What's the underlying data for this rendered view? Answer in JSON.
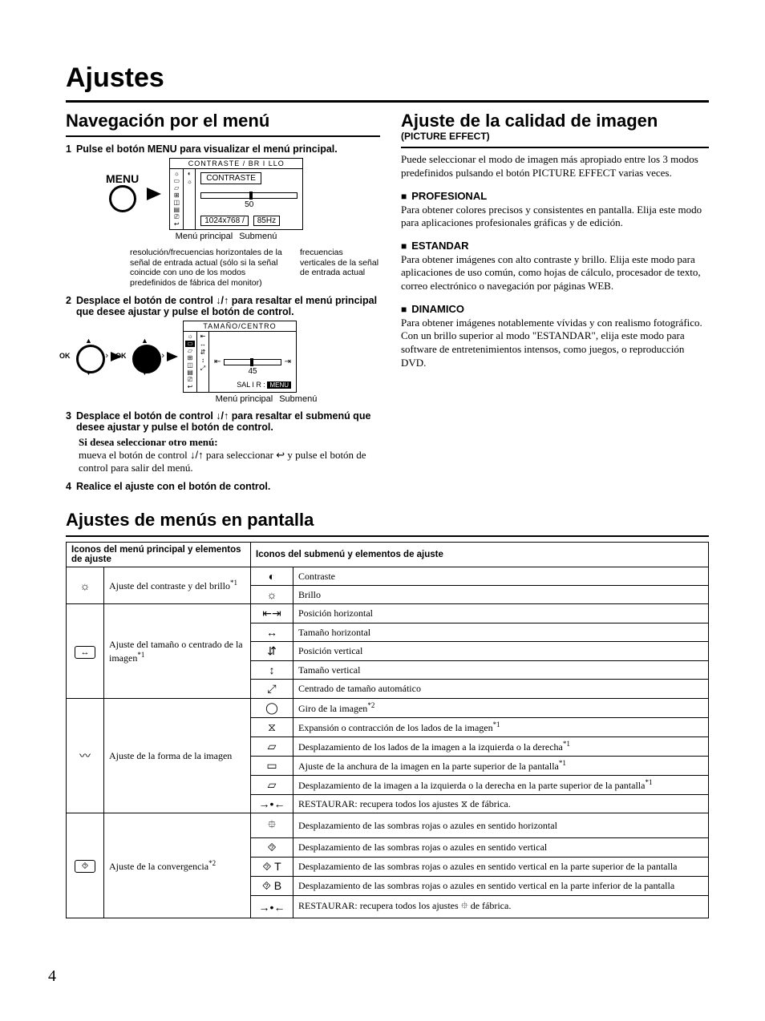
{
  "title": "Ajustes",
  "page_number": "4",
  "left": {
    "heading": "Navegación por el menú",
    "step1_num": "1",
    "step1_txt": "Pulse el botón MENU para visualizar el menú principal.",
    "menu_label": "MENU",
    "osd1": {
      "title": "CONTRASTE / BR I LLO",
      "item": "CONTRASTE",
      "value": "50",
      "res": "1024x768 /",
      "hz": "85Hz"
    },
    "fig1_cap_main": "Menú principal",
    "fig1_cap_sub": "Submenú",
    "note_left": "resolución/frecuencias horizontales de la señal de entrada actual (sólo si la señal coincide con uno de los modos predefinidos de fábrica del monitor)",
    "note_right": "frecuencias verticales de la señal de entrada actual",
    "step2_num": "2",
    "step2_txt": "Desplace el botón de control ↓/↑ para resaltar el menú principal que desee ajustar y pulse el botón de control.",
    "osd2": {
      "title": "TAMAÑO/CENTRO",
      "value": "45",
      "exit": "SAL I R :"
    },
    "fig2_cap_main": "Menú principal",
    "fig2_cap_sub": "Submenú",
    "step3_num": "3",
    "step3_txt": "Desplace el botón de control ↓/↑ para resaltar el submenú que desee ajustar y pulse el botón de control.",
    "step3_sub1": "Si desea seleccionar otro menú:",
    "step3_sub2a": "mueva el botón de control ",
    "step3_sub2b": " para seleccionar ",
    "step3_sub2c": " y pulse el botón de control para salir del menú.",
    "updown_glyph": "↓/↑",
    "return_glyph": "↩",
    "step4_num": "4",
    "step4_txt": "Realice el ajuste con el botón de control."
  },
  "right": {
    "heading": "Ajuste de la calidad de imagen",
    "subheading": "(PICTURE EFFECT)",
    "intro": "Puede seleccionar el modo de imagen más apropiado entre los 3 modos predefinidos pulsando el botón PICTURE EFFECT varias veces.",
    "m1": "PROFESIONAL",
    "m1_txt": "Para obtener colores precisos y consistentes en pantalla. Elija este modo para aplicaciones profesionales gráficas y de edición.",
    "m2": "ESTANDAR",
    "m2_txt": "Para obtener imágenes con alto contraste y brillo. Elija este modo para aplicaciones de uso común, como hojas de cálculo, procesador de texto, correo electrónico o navegación por páginas WEB.",
    "m3": "DINAMICO",
    "m3_txt": "Para obtener imágenes notablemente vívidas y con realismo fotográfico. Con un brillo superior al modo \"ESTANDAR\", elija este modo para software de entretenimientos intensos, como juegos, o reproducción DVD."
  },
  "lower": {
    "heading": "Ajustes de menús en pantalla",
    "th_main": "Iconos del menú principal y elementos de ajuste",
    "th_sub": "Iconos del submenú y elementos de ajuste",
    "groups": [
      {
        "icon": "☼",
        "desc": "Ajuste del contraste y del brillo",
        "note": "*1",
        "rows": [
          {
            "icon": "◐",
            "txt": "Contraste"
          },
          {
            "icon": "☼",
            "txt": "Brillo"
          }
        ]
      },
      {
        "icon": "↔",
        "boxed": true,
        "desc": "Ajuste del tamaño o centrado de la imagen",
        "note": "*1",
        "rows": [
          {
            "icon": "⇤⇥",
            "txt": "Posición horizontal"
          },
          {
            "icon": "↔",
            "txt": "Tamaño horizontal"
          },
          {
            "icon": "⇵",
            "txt": "Posición vertical"
          },
          {
            "icon": "↕",
            "txt": "Tamaño vertical"
          },
          {
            "icon": "⤢",
            "txt": "Centrado de tamaño automático"
          }
        ]
      },
      {
        "icon": "〰",
        "desc": "Ajuste de la forma de la imagen",
        "rows": [
          {
            "icon": "◯",
            "txt": "Giro de la imagen",
            "note": "*2"
          },
          {
            "icon": "⧖",
            "txt": "Expansión o contracción de los lados de la imagen",
            "note": "*1"
          },
          {
            "icon": "▱",
            "txt": "Desplazamiento de los lados de la imagen a la izquierda o la derecha",
            "note": "*1"
          },
          {
            "icon": "▭",
            "txt": "Ajuste de la anchura de la imagen en la parte superior de la pantalla",
            "note": "*1"
          },
          {
            "icon": "▱",
            "txt": "Desplazamiento de la imagen a la izquierda o la derecha en la parte superior de la pantalla",
            "note": "*1"
          },
          {
            "icon": "→•←",
            "txt_pre": "RESTAURAR: recupera todos los ajustes ",
            "icon2": "⧖",
            "txt_post": " de fábrica."
          }
        ]
      },
      {
        "icon": "⯑",
        "boxed": true,
        "desc": "Ajuste de la convergencia",
        "note": "*2",
        "rows": [
          {
            "icon": "⯐",
            "txt": "Desplazamiento de las sombras rojas o azules en sentido horizontal"
          },
          {
            "icon": "⯑",
            "txt": "Desplazamiento de las sombras rojas o azules en sentido vertical"
          },
          {
            "icon": "⯑ T",
            "txt": "Desplazamiento de las sombras rojas o azules en sentido vertical en la parte superior de la pantalla"
          },
          {
            "icon": "⯑ B",
            "txt": "Desplazamiento de las sombras rojas o azules en sentido vertical en la parte inferior de la pantalla"
          },
          {
            "icon": "→•←",
            "txt_pre": "RESTAURAR: recupera todos los ajustes ",
            "icon2": "⯐",
            "txt_post": " de fábrica."
          }
        ]
      }
    ]
  }
}
